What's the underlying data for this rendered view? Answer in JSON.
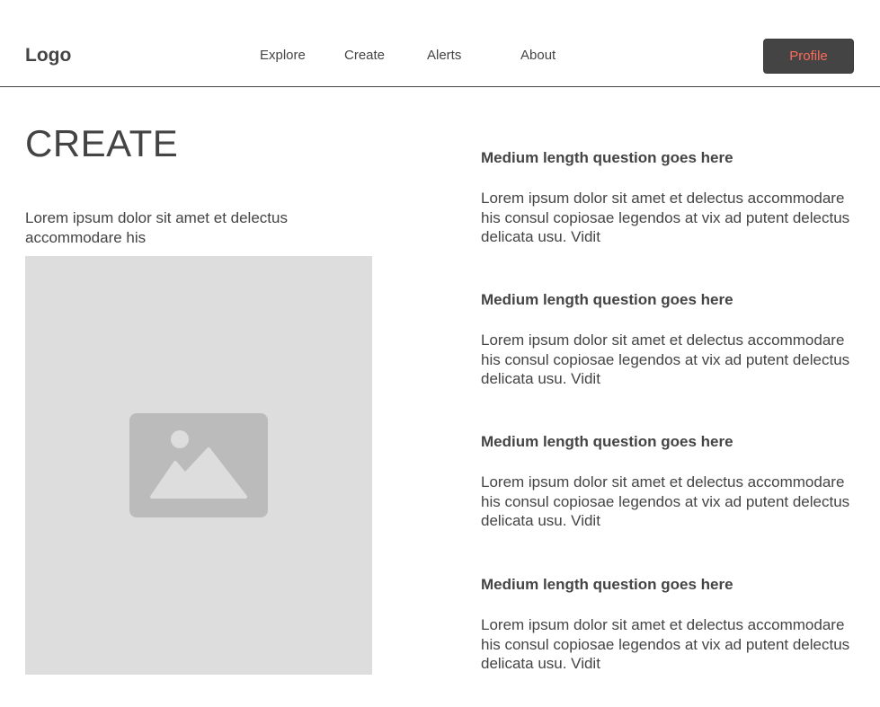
{
  "header": {
    "logo": "Logo",
    "nav": [
      "Explore",
      "Create",
      "Alerts",
      "About"
    ],
    "profile_label": "Profile",
    "profile_text_color": "#ff6b5a",
    "profile_bg_color": "#444444"
  },
  "main": {
    "title": "CREATE",
    "intro": "Lorem ipsum dolor sit amet et delectus accommodare his",
    "image_icon": "image-placeholder-icon"
  },
  "faq": [
    {
      "question": "Medium length question goes here",
      "answer": "Lorem ipsum dolor sit amet et delectus accommodare his consul copiosae legendos at vix ad putent delectus delicata usu. Vidit"
    },
    {
      "question": "Medium length question goes here",
      "answer": "Lorem ipsum dolor sit amet et delectus accommodare his consul copiosae legendos at vix ad putent delectus delicata usu. Vidit"
    },
    {
      "question": "Medium length question goes here",
      "answer": "Lorem ipsum dolor sit amet et delectus accommodare his consul copiosae legendos at vix ad putent delectus delicata usu. Vidit"
    },
    {
      "question": "Medium length question goes here",
      "answer": "Lorem ipsum dolor sit amet et delectus accommodare his consul copiosae legendos at vix ad putent delectus delicata usu. Vidit"
    }
  ]
}
